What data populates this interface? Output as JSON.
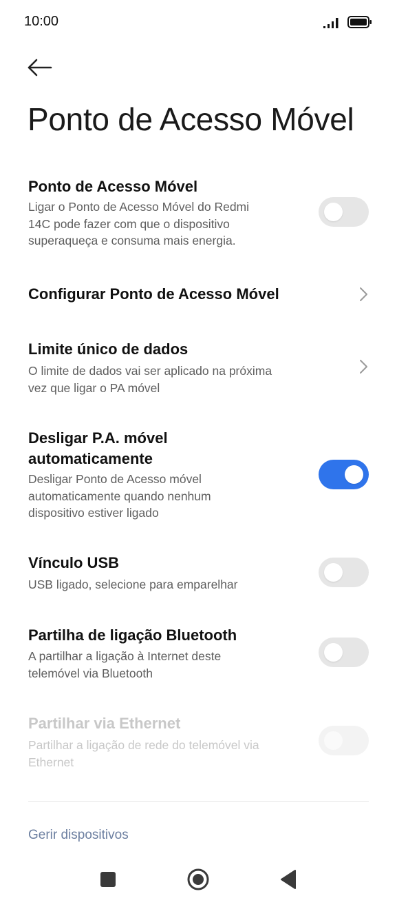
{
  "status_bar": {
    "time": "10:00"
  },
  "header": {
    "title": "Ponto de Acesso Móvel"
  },
  "settings": [
    {
      "title": "Ponto de Acesso Móvel",
      "subtitle_lines": [
        "Ligar o Ponto de Acesso Móvel do Redmi",
        "14C pode fazer com que o dispositivo",
        "superaqueça e consuma mais energia."
      ],
      "control": "toggle",
      "enabled": false
    },
    {
      "title": "Configurar Ponto de Acesso Móvel",
      "control": "chevron"
    },
    {
      "title": "Limite único de dados",
      "subtitle_lines": [
        "O limite de dados vai ser aplicado na próxima",
        "vez que ligar o PA móvel"
      ],
      "control": "chevron"
    },
    {
      "title_lines": [
        "Desligar P.A. móvel",
        "automaticamente"
      ],
      "subtitle_lines": [
        "Desligar Ponto de Acesso móvel",
        "automaticamente quando nenhum",
        "dispositivo estiver ligado"
      ],
      "control": "toggle",
      "enabled": true
    },
    {
      "title": "Vínculo USB",
      "subtitle_lines": [
        "USB ligado, selecione para emparelhar"
      ],
      "control": "toggle",
      "enabled": false
    },
    {
      "title": "Partilha de ligação Bluetooth",
      "subtitle_lines": [
        "A partilhar a ligação à Internet deste",
        "telemóvel via Bluetooth"
      ],
      "control": "toggle",
      "enabled": false
    },
    {
      "title": "Partilhar via Ethernet",
      "subtitle_lines": [
        "Partilhar a ligação de rede do telemóvel via",
        "Ethernet"
      ],
      "control": "toggle",
      "enabled": false,
      "disabled": true
    }
  ],
  "footer": {
    "manage_devices": "Gerir dispositivos"
  },
  "colors": {
    "accent": "#2f74eb",
    "toggle_off": "#e6e6e6",
    "link": "#6c7fa0"
  }
}
